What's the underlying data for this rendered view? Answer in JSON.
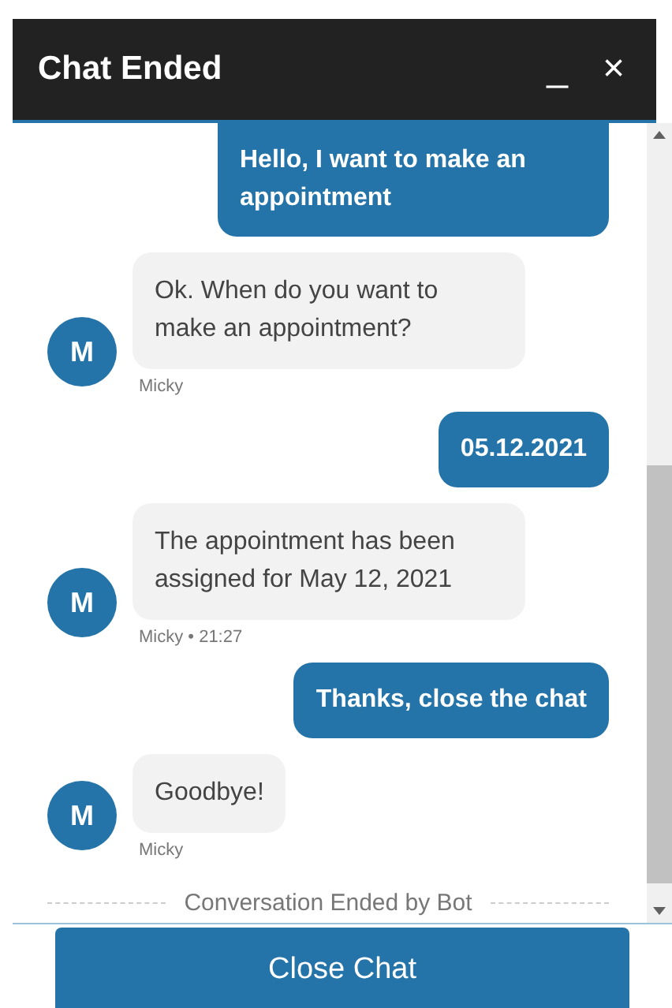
{
  "header": {
    "title": "Chat Ended",
    "minimize": "_",
    "close": "×"
  },
  "messages": [
    {
      "kind": "user",
      "text": "Hello, I want to make an appointment"
    },
    {
      "kind": "bot",
      "avatar": "M",
      "text": "Ok. When do you want to make an appointment?",
      "meta": "Micky"
    },
    {
      "kind": "user",
      "text": "05.12.2021"
    },
    {
      "kind": "bot",
      "avatar": "M",
      "text": "The appointment has been assigned for May 12, 2021",
      "meta": "Micky • 21:27"
    },
    {
      "kind": "user",
      "text": "Thanks, close the chat"
    },
    {
      "kind": "bot",
      "avatar": "M",
      "text": "Goodbye!",
      "meta": "Micky"
    }
  ],
  "status": "Conversation Ended by Bot",
  "footer": {
    "button": "Close Chat"
  }
}
